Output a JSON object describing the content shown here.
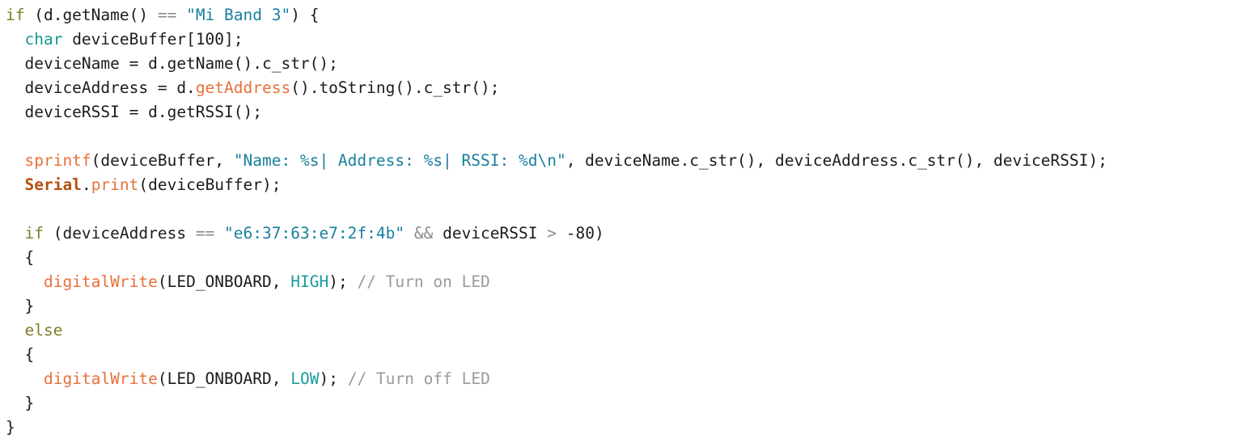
{
  "editor": {
    "language": "cpp",
    "background_color": "#ffffff",
    "default_text_color": "#1c1c1c",
    "font_size_px": 19.5,
    "line_height_px": 30,
    "line_count": 18
  },
  "theme": {
    "keyword_color": "#7f7f2a",
    "type_color": "#0f9b8e",
    "string_color": "#1a7f9e",
    "function_color": "#e8703a",
    "class_color": "#b4500f",
    "constant_color": "#1a9b9b",
    "comment_color": "#9a9a9a",
    "operator_color": "#8a8a8a",
    "plain_color": "#1c1c1c"
  },
  "code": {
    "lines": [
      {
        "id": "line-1",
        "tokens": [
          {
            "t": "if",
            "c": "keyword"
          },
          {
            "t": " (d.getName() ",
            "c": "plain"
          },
          {
            "t": "==",
            "c": "operator"
          },
          {
            "t": " ",
            "c": "plain"
          },
          {
            "t": "\"Mi Band 3\"",
            "c": "string"
          },
          {
            "t": ") {",
            "c": "plain"
          }
        ]
      },
      {
        "id": "line-2",
        "tokens": [
          {
            "t": "  ",
            "c": "plain"
          },
          {
            "t": "char",
            "c": "type"
          },
          {
            "t": " deviceBuffer[100];",
            "c": "plain"
          }
        ]
      },
      {
        "id": "line-3",
        "tokens": [
          {
            "t": "  deviceName = d.getName().c_str();",
            "c": "plain"
          }
        ]
      },
      {
        "id": "line-4",
        "tokens": [
          {
            "t": "  deviceAddress = d.",
            "c": "plain"
          },
          {
            "t": "getAddress",
            "c": "func"
          },
          {
            "t": "().toString().c_str();",
            "c": "plain"
          }
        ]
      },
      {
        "id": "line-5",
        "tokens": [
          {
            "t": "  deviceRSSI = d.getRSSI();",
            "c": "plain"
          }
        ]
      },
      {
        "id": "line-6",
        "tokens": []
      },
      {
        "id": "line-7",
        "tokens": [
          {
            "t": "  ",
            "c": "plain"
          },
          {
            "t": "sprintf",
            "c": "func"
          },
          {
            "t": "(deviceBuffer, ",
            "c": "plain"
          },
          {
            "t": "\"Name: %s| Address: %s| RSSI: %d\\n\"",
            "c": "string"
          },
          {
            "t": ", deviceName.c_str(), deviceAddress.c_str(), deviceRSSI);",
            "c": "plain"
          }
        ]
      },
      {
        "id": "line-8",
        "tokens": [
          {
            "t": "  ",
            "c": "plain"
          },
          {
            "t": "Serial",
            "c": "class"
          },
          {
            "t": ".",
            "c": "plain"
          },
          {
            "t": "print",
            "c": "func"
          },
          {
            "t": "(deviceBuffer);",
            "c": "plain"
          }
        ]
      },
      {
        "id": "line-9",
        "tokens": []
      },
      {
        "id": "line-10",
        "tokens": [
          {
            "t": "  ",
            "c": "plain"
          },
          {
            "t": "if",
            "c": "keyword"
          },
          {
            "t": " (deviceAddress ",
            "c": "plain"
          },
          {
            "t": "==",
            "c": "operator"
          },
          {
            "t": " ",
            "c": "plain"
          },
          {
            "t": "\"e6:37:63:e7:2f:4b\"",
            "c": "string"
          },
          {
            "t": " ",
            "c": "plain"
          },
          {
            "t": "&&",
            "c": "operator"
          },
          {
            "t": " deviceRSSI ",
            "c": "plain"
          },
          {
            "t": ">",
            "c": "operator"
          },
          {
            "t": " ",
            "c": "plain"
          },
          {
            "t": "-80",
            "c": "number"
          },
          {
            "t": ")",
            "c": "plain"
          }
        ]
      },
      {
        "id": "line-11",
        "tokens": [
          {
            "t": "  {",
            "c": "plain"
          }
        ]
      },
      {
        "id": "line-12",
        "tokens": [
          {
            "t": "    ",
            "c": "plain"
          },
          {
            "t": "digitalWrite",
            "c": "func"
          },
          {
            "t": "(LED_ONBOARD, ",
            "c": "plain"
          },
          {
            "t": "HIGH",
            "c": "const"
          },
          {
            "t": "); ",
            "c": "plain"
          },
          {
            "t": "// Turn on LED",
            "c": "comment"
          }
        ]
      },
      {
        "id": "line-13",
        "tokens": [
          {
            "t": "  }",
            "c": "plain"
          }
        ]
      },
      {
        "id": "line-14",
        "tokens": [
          {
            "t": "  ",
            "c": "plain"
          },
          {
            "t": "else",
            "c": "keyword"
          }
        ]
      },
      {
        "id": "line-15",
        "tokens": [
          {
            "t": "  {",
            "c": "plain"
          }
        ]
      },
      {
        "id": "line-16",
        "tokens": [
          {
            "t": "    ",
            "c": "plain"
          },
          {
            "t": "digitalWrite",
            "c": "func"
          },
          {
            "t": "(LED_ONBOARD, ",
            "c": "plain"
          },
          {
            "t": "LOW",
            "c": "const"
          },
          {
            "t": "); ",
            "c": "plain"
          },
          {
            "t": "// Turn off LED",
            "c": "comment"
          }
        ]
      },
      {
        "id": "line-17",
        "tokens": [
          {
            "t": "  }",
            "c": "plain"
          }
        ]
      },
      {
        "id": "line-18",
        "tokens": [
          {
            "t": "}",
            "c": "plain"
          }
        ]
      }
    ]
  }
}
